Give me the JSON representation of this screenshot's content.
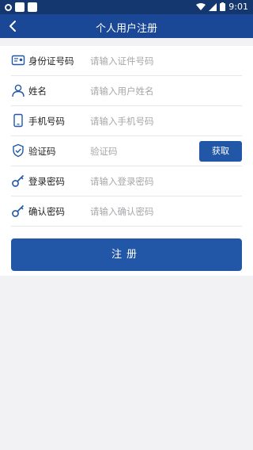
{
  "status_bar": {
    "time": "9:01"
  },
  "header": {
    "title": "个人用户注册"
  },
  "form": {
    "fields": [
      {
        "label": "身份证号码",
        "placeholder": "请输入证件号码",
        "icon": "id-card-icon"
      },
      {
        "label": "姓名",
        "placeholder": "请输入用户姓名",
        "icon": "person-icon"
      },
      {
        "label": "手机号码",
        "placeholder": "请输入手机号码",
        "icon": "phone-icon"
      },
      {
        "label": "验证码",
        "placeholder": "验证码",
        "icon": "shield-check-icon"
      },
      {
        "label": "登录密码",
        "placeholder": "请输入登录密码",
        "icon": "key-icon"
      },
      {
        "label": "确认密码",
        "placeholder": "请输入确认密码",
        "icon": "key-icon"
      }
    ],
    "get_code_label": "获取",
    "submit_label": "注册"
  },
  "colors": {
    "primary": "#2157a6",
    "header": "#1a4796",
    "statusbar": "#15376f",
    "background": "#f2f2f5"
  }
}
